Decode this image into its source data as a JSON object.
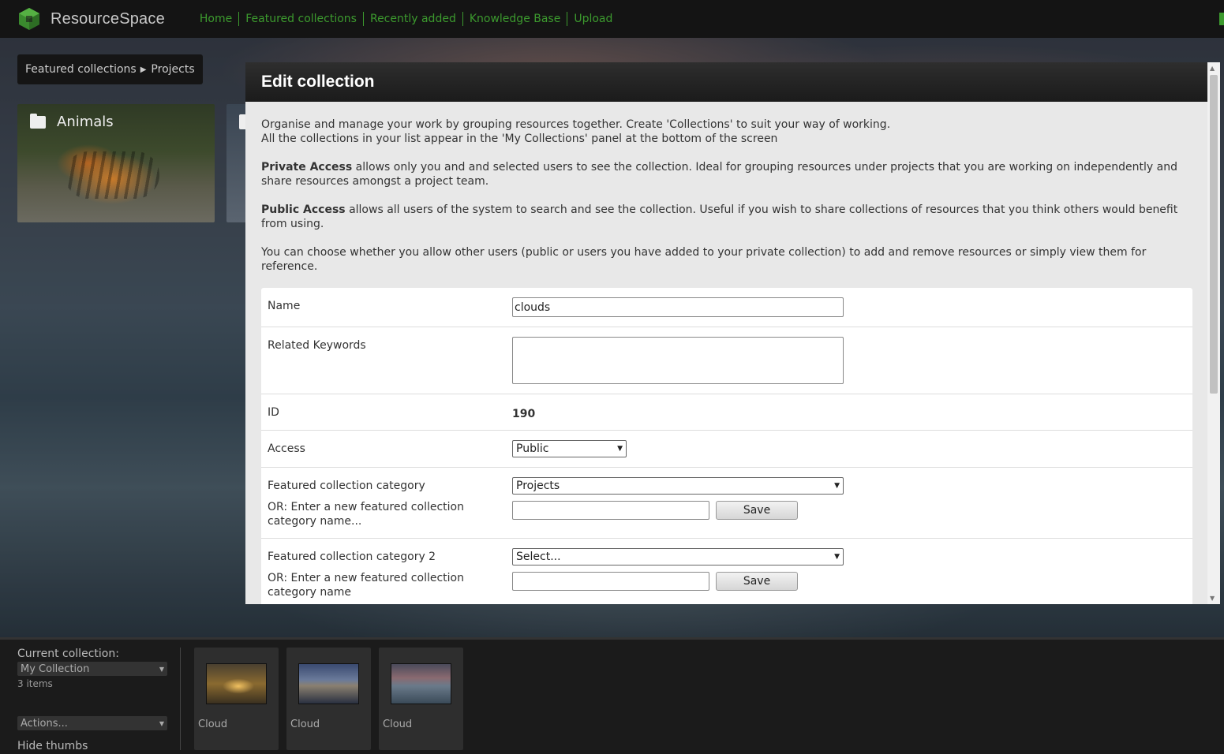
{
  "header": {
    "logo_text": "ResourceSpace",
    "nav": [
      "Home",
      "Featured collections",
      "Recently added",
      "Knowledge Base",
      "Upload"
    ],
    "accent_color": "#3c9a2e"
  },
  "breadcrumb": {
    "items": [
      "Featured collections",
      "Projects"
    ]
  },
  "tiles": [
    {
      "label": "Animals",
      "icon": "folder-icon"
    }
  ],
  "modal": {
    "title": "Edit collection",
    "intro": [
      {
        "bold": "",
        "text": "Organise and manage your work by grouping resources together. Create 'Collections' to suit your way of working."
      },
      {
        "bold": "",
        "text": "All the collections in your list appear in the 'My Collections' panel at the bottom of the screen"
      },
      {
        "bold": "Private Access",
        "text": " allows only you and and selected users to see the collection. Ideal for grouping resources under projects that you are working on independently and share resources amongst a project team."
      },
      {
        "bold": "Public Access",
        "text": " allows all users of the system to search and see the collection. Useful if you wish to share collections of resources that you think others would benefit from using."
      },
      {
        "bold": "",
        "text": "You can choose whether you allow other users (public or users you have added to your private collection) to add and remove resources or simply view them for reference."
      }
    ],
    "form": {
      "name_label": "Name",
      "name_value": "clouds",
      "keywords_label": "Related Keywords",
      "id_label": "ID",
      "id_value": "190",
      "access_label": "Access",
      "access_value": "Public",
      "category_label": "Featured collection category",
      "category_value": "Projects",
      "new_category_label": "OR: Enter a new featured collection category name...",
      "save_label": "Save",
      "category2_label": "Featured collection category 2",
      "category2_value": "Select...",
      "new_category2_label": "OR: Enter a new featured collection category name",
      "save2_label": "Save"
    }
  },
  "collection_bar": {
    "current_label": "Current collection:",
    "collection_name": "My Collection",
    "item_count": "3 items",
    "actions_label": "Actions...",
    "hide_thumbs": "Hide thumbs",
    "thumbs": [
      {
        "label": "Cloud"
      },
      {
        "label": "Cloud"
      },
      {
        "label": "Cloud"
      }
    ]
  }
}
